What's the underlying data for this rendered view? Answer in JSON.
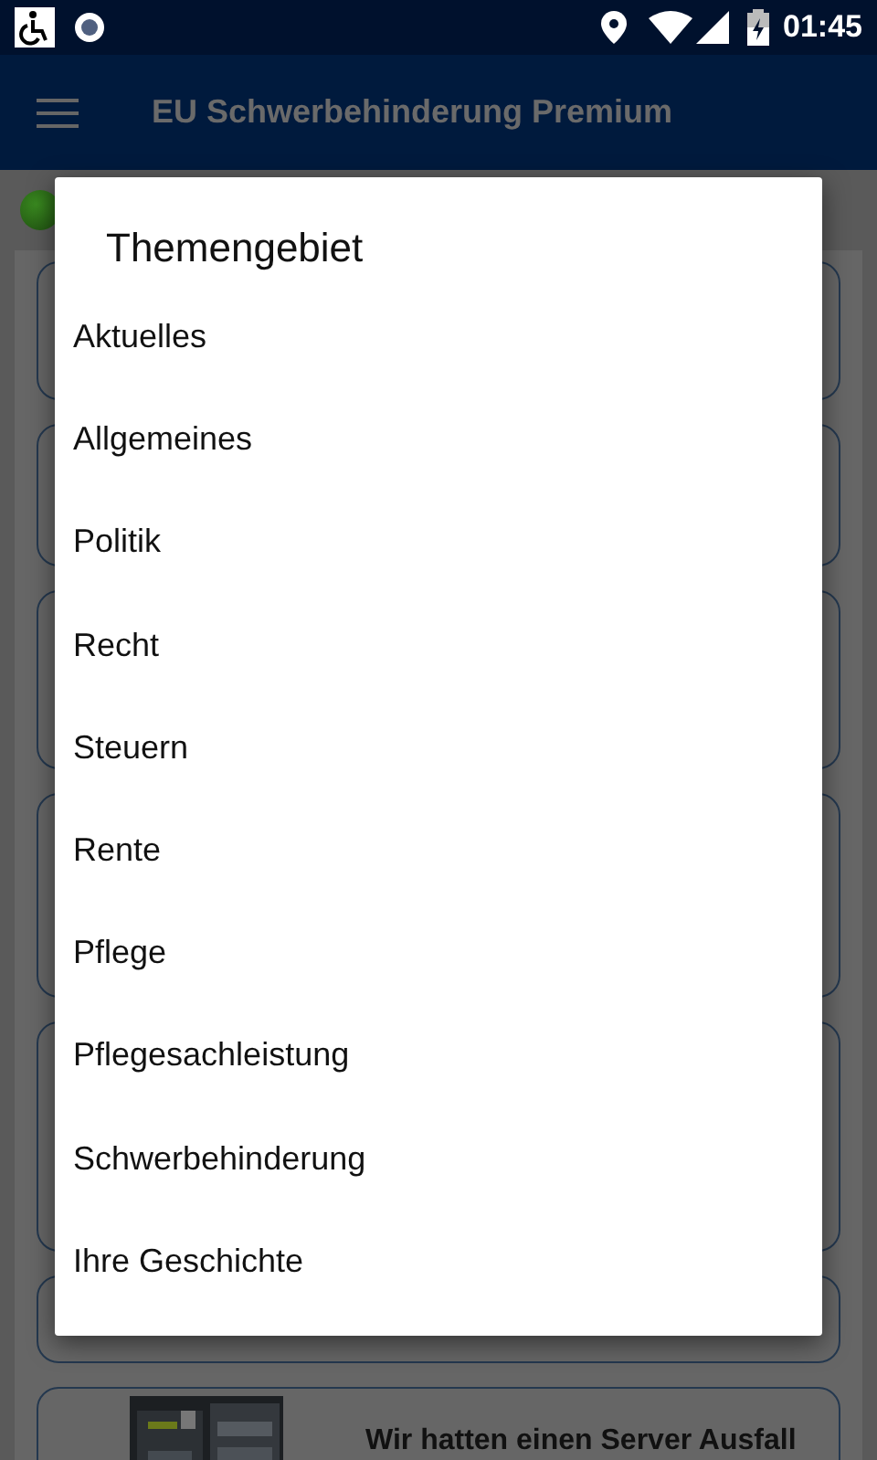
{
  "status_bar": {
    "time": "01:45"
  },
  "app_bar": {
    "title": "EU Schwerbehinderung Premium"
  },
  "news": {
    "cards": [
      {
        "kind": "blank"
      },
      {
        "kind": "blank"
      },
      {
        "kind": "blank"
      },
      {
        "kind": "blank"
      },
      {
        "kind": "blank"
      },
      {
        "kind": "blank"
      },
      {
        "kind": "article",
        "title": "Wir hatten einen Server Ausfall"
      }
    ]
  },
  "dialog": {
    "title": "Themengebiet",
    "items": [
      {
        "label": "Aktuelles"
      },
      {
        "label": "Allgemeines"
      },
      {
        "label": "Politik"
      },
      {
        "label": "Recht"
      },
      {
        "label": "Steuern"
      },
      {
        "label": "Rente"
      },
      {
        "label": "Pflege"
      },
      {
        "label": "Pflegesachleistung"
      },
      {
        "label": "Schwerbehinderung"
      },
      {
        "label": "Ihre Geschichte"
      }
    ]
  }
}
